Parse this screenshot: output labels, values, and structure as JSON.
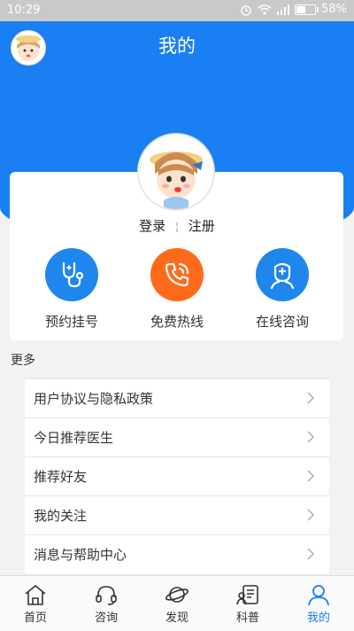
{
  "status_bar": {
    "time": "10:29",
    "battery": "58%",
    "battery_level": 0.58
  },
  "header": {
    "title": "我的"
  },
  "auth": {
    "login": "登录",
    "register": "注册"
  },
  "quick_actions": [
    {
      "label": "预约挂号",
      "icon": "stethoscope-icon",
      "color": "#1f86ee"
    },
    {
      "label": "免费热线",
      "icon": "phone-icon",
      "color": "#ff6a1a"
    },
    {
      "label": "在线咨询",
      "icon": "doctor-icon",
      "color": "#1f86ee"
    }
  ],
  "more": {
    "title": "更多",
    "items": [
      {
        "label": "用户协议与隐私政策"
      },
      {
        "label": "今日推荐医生"
      },
      {
        "label": "推荐好友"
      },
      {
        "label": "我的关注"
      },
      {
        "label": "消息与帮助中心"
      }
    ]
  },
  "tabs": [
    {
      "label": "首页",
      "icon": "home-icon"
    },
    {
      "label": "咨询",
      "icon": "headset-icon"
    },
    {
      "label": "发现",
      "icon": "planet-icon"
    },
    {
      "label": "科普",
      "icon": "article-icon"
    },
    {
      "label": "我的",
      "icon": "person-icon",
      "active": true
    }
  ],
  "colors": {
    "brand_blue": "#1a7ff2",
    "hotline_orange": "#ff6a1a"
  }
}
